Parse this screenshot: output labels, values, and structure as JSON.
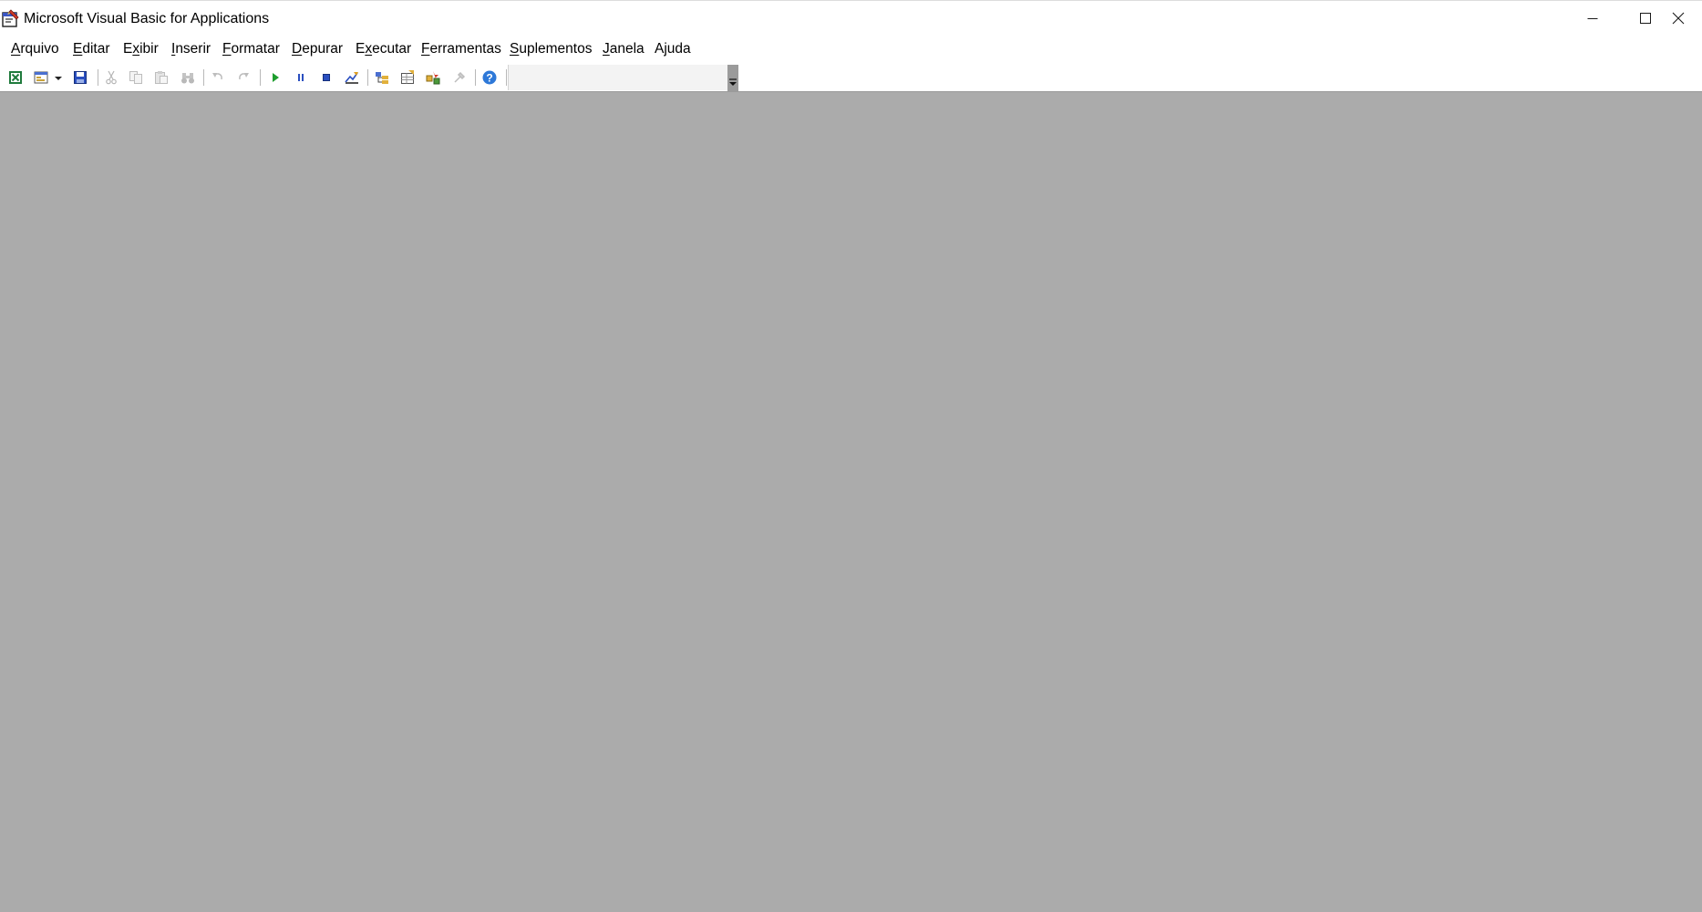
{
  "window": {
    "title": "Microsoft Visual Basic for Applications",
    "icon": "vba-app-icon",
    "controls": [
      "minimize-icon",
      "maximize-icon",
      "close-icon"
    ]
  },
  "menu": [
    {
      "label": "Arquivo",
      "accel": "A",
      "rest": "rquivo"
    },
    {
      "label": "Editar",
      "accel": "E",
      "rest": "ditar"
    },
    {
      "label": "Exibir",
      "pre": "E",
      "accel": "x",
      "rest": "ibir"
    },
    {
      "label": "Inserir",
      "accel": "I",
      "rest": "nserir"
    },
    {
      "label": "Formatar",
      "accel": "F",
      "rest": "ormatar"
    },
    {
      "label": "Depurar",
      "accel": "D",
      "rest": "epurar"
    },
    {
      "label": "Executar",
      "pre": "E",
      "accel": "x",
      "rest": "ecutar"
    },
    {
      "label": "Ferramentas",
      "accel": "F",
      "rest": "erramentas"
    },
    {
      "label": "Suplementos",
      "accel": "S",
      "rest": "uplementos"
    },
    {
      "label": "Janela",
      "accel": "J",
      "rest": "anela"
    },
    {
      "label": "Ajuda",
      "pre": "A",
      "accel": "j",
      "rest": "uda"
    }
  ],
  "toolbar": {
    "buttons": [
      {
        "name": "view-excel-button",
        "icon": "excel-icon",
        "enabled": true
      },
      {
        "name": "insert-userform-button",
        "icon": "userform-icon",
        "enabled": true
      },
      {
        "name": "insert-dropdown-button",
        "icon": "chevron-down-icon",
        "enabled": true
      },
      {
        "name": "save-button",
        "icon": "save-icon",
        "enabled": true
      },
      {
        "name": "cut-button",
        "icon": "scissors-icon",
        "enabled": false
      },
      {
        "name": "copy-button",
        "icon": "copy-icon",
        "enabled": false
      },
      {
        "name": "paste-button",
        "icon": "paste-icon",
        "enabled": false
      },
      {
        "name": "find-button",
        "icon": "binoculars-icon",
        "enabled": false
      },
      {
        "name": "undo-button",
        "icon": "undo-icon",
        "enabled": false
      },
      {
        "name": "redo-button",
        "icon": "redo-icon",
        "enabled": false
      },
      {
        "name": "run-button",
        "icon": "play-icon",
        "enabled": true
      },
      {
        "name": "break-button",
        "icon": "pause-icon",
        "enabled": true
      },
      {
        "name": "reset-button",
        "icon": "stop-icon",
        "enabled": true
      },
      {
        "name": "design-mode-button",
        "icon": "design-mode-icon",
        "enabled": true
      },
      {
        "name": "project-explorer-button",
        "icon": "project-explorer-icon",
        "enabled": true
      },
      {
        "name": "properties-window-button",
        "icon": "properties-icon",
        "enabled": true
      },
      {
        "name": "object-browser-button",
        "icon": "object-browser-icon",
        "enabled": true
      },
      {
        "name": "toolbox-button",
        "icon": "toolbox-icon",
        "enabled": false
      },
      {
        "name": "help-button",
        "icon": "help-icon",
        "enabled": true
      }
    ],
    "position_readout": ""
  },
  "colors": {
    "workspace": "#ababab",
    "chrome": "#ffffff",
    "run_green": "#1e9e2e",
    "vba_blue": "#2a4fc0",
    "help_blue": "#2d78d8"
  }
}
